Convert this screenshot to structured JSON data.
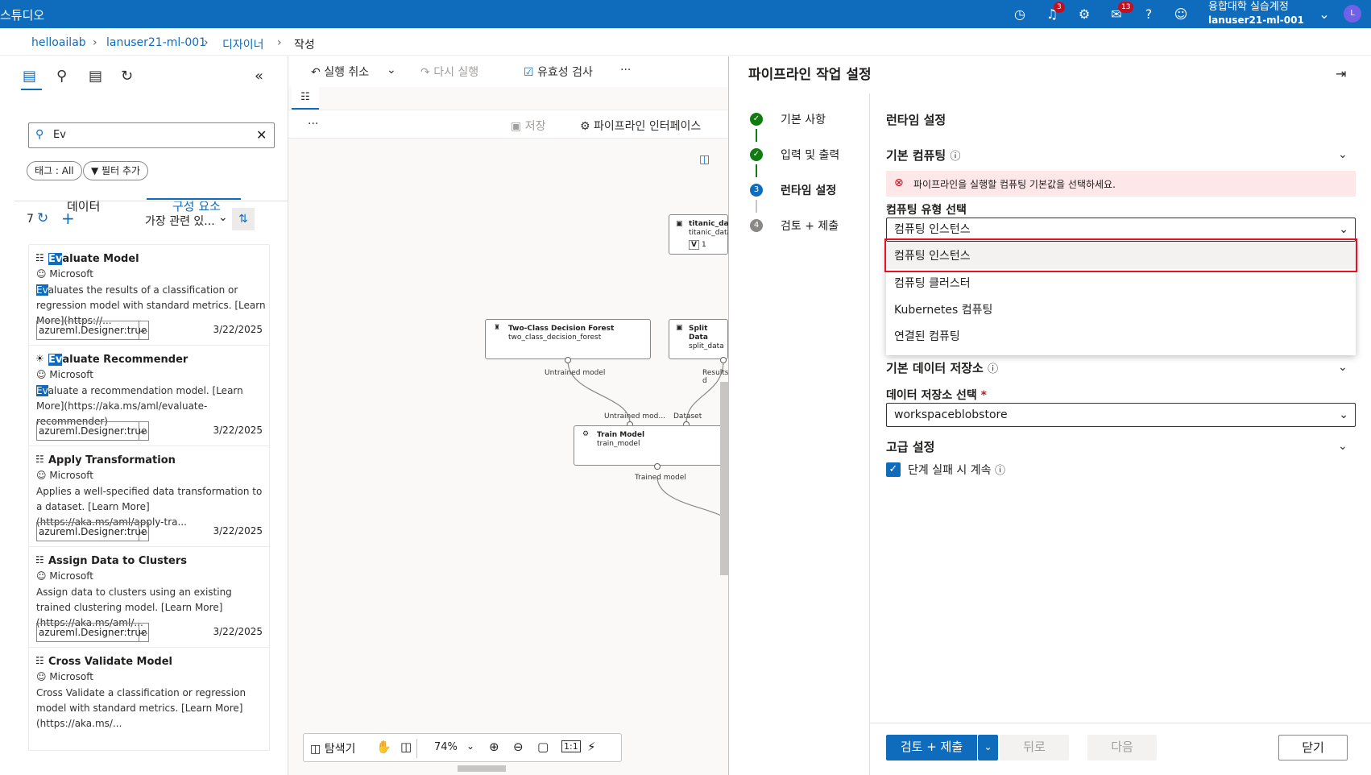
{
  "topbar": {
    "title": "스튜디오",
    "notif_badge": "3",
    "feedback_badge": "13",
    "user_name": "융합대학 실습계정",
    "workspace": "lanuser21-ml-001",
    "avatar": "L",
    "icons": [
      "clock-icon",
      "bell-icon",
      "gear-icon",
      "feedback-icon",
      "help-icon",
      "smiley-icon",
      "chevron-down-icon"
    ]
  },
  "breadcrumb": [
    "helloailab",
    "lanuser21-ml-001",
    "디자이너",
    "작성"
  ],
  "left": {
    "search_value": "Ev",
    "tag_pill": "태그 : All",
    "filter_pill": "필터 추가",
    "tabs": [
      "데이터",
      "구성 요소"
    ],
    "count": "7",
    "sort_label": "가장 관련 있...",
    "cards": [
      {
        "title_hl": "Ev",
        "title_rest": "aluate Model",
        "publisher": "Microsoft",
        "desc_hl": "Ev",
        "desc_rest": "aluates the results of a classification or regression model with standard metrics. [Learn More](https://...",
        "tag": "azureml.Designer:true",
        "more": "...",
        "date": "3/22/2025"
      },
      {
        "title_hl": "Ev",
        "title_rest": "aluate Recommender",
        "publisher": "Microsoft",
        "desc_hl": "Ev",
        "desc_rest": "aluate a recommendation model. [Learn More](https://aka.ms/aml/evaluate-recommender)",
        "tag": "azureml.Designer:true",
        "more": "...",
        "date": "3/22/2025"
      },
      {
        "title_hl": "",
        "title_rest": "Apply Transformation",
        "publisher": "Microsoft",
        "desc_hl": "",
        "desc_rest": "Applies a well-specified data transformation to a dataset. [Learn More](https://aka.ms/aml/apply-tra...",
        "tag": "azureml.Designer:true",
        "more": "...",
        "date": "3/22/2025"
      },
      {
        "title_hl": "",
        "title_rest": "Assign Data to Clusters",
        "publisher": "Microsoft",
        "desc_hl": "",
        "desc_rest": "Assign data to clusters using an existing trained clustering model. [Learn More](https://aka.ms/aml/...",
        "tag": "azureml.Designer:true",
        "more": "...",
        "date": "3/22/2025"
      },
      {
        "title_hl": "",
        "title_rest": "Cross Validate Model",
        "publisher": "Microsoft",
        "desc_hl": "",
        "desc_rest": "Cross Validate a classification or regression model with standard metrics. [Learn More](https://aka.ms/...",
        "tag": "",
        "more": "",
        "date": ""
      }
    ]
  },
  "canvas": {
    "undo": "실행 취소",
    "redo": "다시 실행",
    "validate": "유효성 검사",
    "more": "···",
    "save": "저장",
    "pipeline_interface": "파이프라인 인터페이스",
    "nodes": {
      "titanic_title": "titanic_data",
      "titanic_sub": "titanic_data",
      "titanic_badge": "V",
      "titanic_ver": "1",
      "forest_title": "Two-Class Decision Forest",
      "forest_sub": "two_class_decision_forest",
      "split_title": "Split Data",
      "split_sub": "split_data",
      "train_title": "Train Model",
      "train_sub": "train_model"
    },
    "ports": {
      "untrained": "Untrained model",
      "results": "Results d",
      "untrained2": "Untrained mod...",
      "dataset": "Dataset",
      "trained": "Trained model"
    },
    "bottom": {
      "navigator": "탐색기",
      "zoom": "74%"
    }
  },
  "right": {
    "title": "파이프라인 작업 설정",
    "steps": [
      {
        "label": "기본 사항",
        "state": "done"
      },
      {
        "label": "입력 및 출력",
        "state": "done"
      },
      {
        "label": "런타임 설정",
        "state": "current",
        "num": "3"
      },
      {
        "label": "검토 + 제출",
        "state": "todo",
        "num": "4"
      }
    ],
    "runtime_heading": "런타임 설정",
    "default_compute": "기본 컴퓨팅",
    "error_msg": "파이프라인을 실행할 컴퓨팅 기본값을 선택하세요.",
    "compute_type_label": "컴퓨팅 유형 선택",
    "compute_type_value": "컴퓨팅 인스턴스",
    "options": [
      "컴퓨팅 인스턴스",
      "컴퓨팅 클러스터",
      "Kubernetes 컴퓨팅",
      "연결된 컴퓨팅"
    ],
    "datastore_heading": "기본 데이터 저장소",
    "datastore_label": "데이터 저장소 선택",
    "required_mark": "*",
    "datastore_value": "workspaceblobstore",
    "advanced_heading": "고급 설정",
    "continue_on_fail": "단계 실패 시 계속",
    "buttons": {
      "submit": "검토 + 제출",
      "back": "뒤로",
      "next": "다음",
      "close": "닫기"
    }
  },
  "colors": {
    "accent": "#0f6cbd",
    "success": "#107c10",
    "error_bg": "#fde7e9",
    "error": "#c50f1f",
    "highlight_box": "#e81123"
  }
}
